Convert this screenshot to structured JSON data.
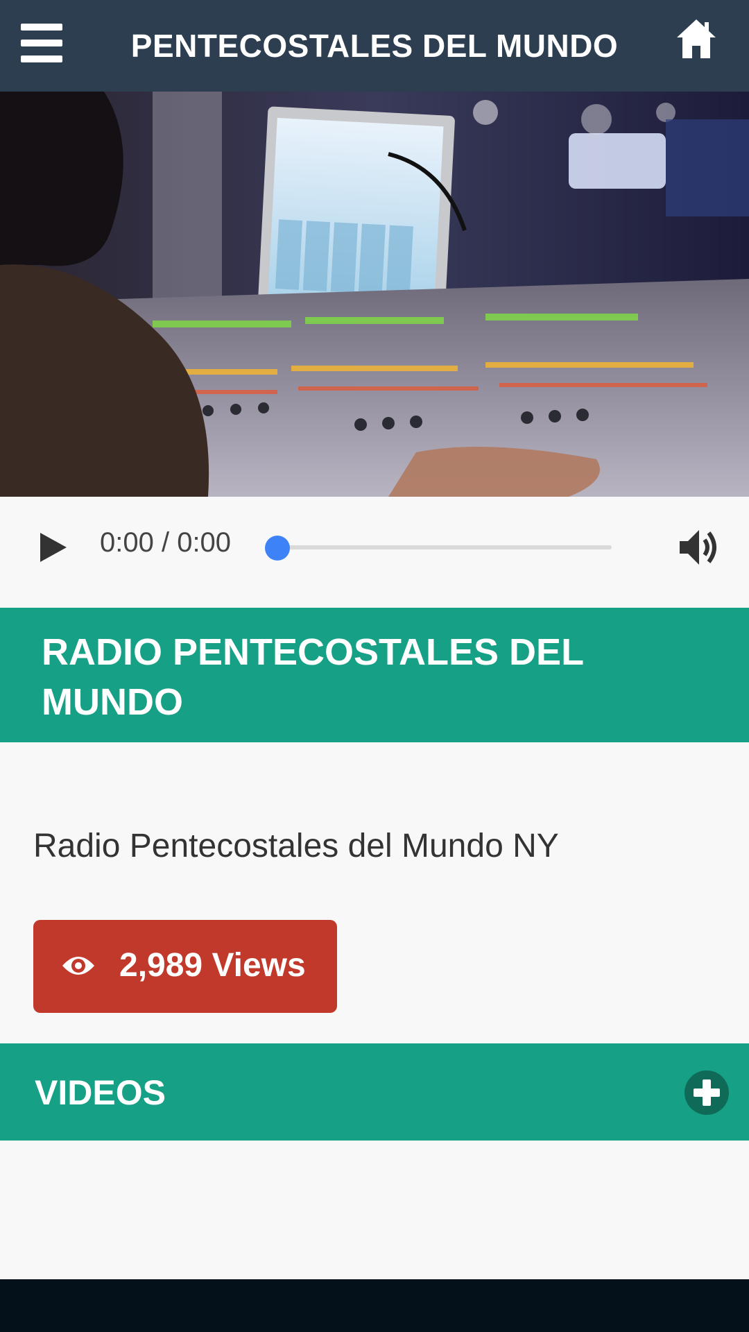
{
  "header": {
    "title": "PENTECOSTALES DEL MUNDO",
    "menu_icon": "hamburger-menu-icon",
    "home_icon": "home-icon"
  },
  "hero_image": {
    "subject": "audio mixing console with monitor in a studio"
  },
  "player": {
    "time": "0:00 / 0:00",
    "progress": 0,
    "play_icon": "play-icon",
    "volume_icon": "volume-icon"
  },
  "station": {
    "title": "RADIO PENTECOSTALES DEL MUNDO",
    "description": "Radio Pentecostales del Mundo NY"
  },
  "views": {
    "label": "2,989 Views",
    "icon": "eye-icon"
  },
  "videos": {
    "label": "VIDEOS",
    "icon": "plus-circle-icon"
  },
  "colors": {
    "header": "#2c3e50",
    "accent": "#16a085",
    "views": "#c0392b",
    "progress": "#3e82f7"
  }
}
